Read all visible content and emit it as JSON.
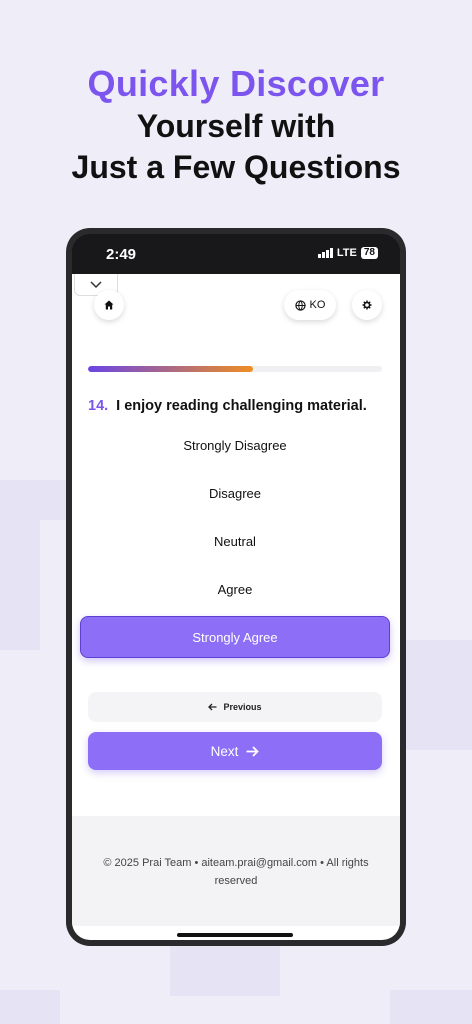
{
  "headline": {
    "accent": "Quickly Discover",
    "line1": "Yourself with",
    "line2": "Just a Few Questions"
  },
  "statusbar": {
    "time": "2:49",
    "network": "LTE",
    "battery": "78"
  },
  "app": {
    "language_label": "KO",
    "progress_fraction": 0.56,
    "question": {
      "number": "14.",
      "text": "I enjoy reading challenging material."
    },
    "options": [
      {
        "label": "Strongly Disagree",
        "selected": false
      },
      {
        "label": "Disagree",
        "selected": false
      },
      {
        "label": "Neutral",
        "selected": false
      },
      {
        "label": "Agree",
        "selected": false
      },
      {
        "label": "Strongly Agree",
        "selected": true
      }
    ],
    "previous_label": "Previous",
    "next_label": "Next",
    "footer": "© 2025 Prai Team • aiteam.prai@gmail.com • All rights reserved"
  },
  "colors": {
    "accent": "#7b55ee",
    "button": "#8d6ef7",
    "progress_start": "#6a45e6",
    "progress_end": "#ee8e22"
  },
  "icons": [
    "chevron-down-icon",
    "home-icon",
    "globe-icon",
    "gear-icon",
    "arrow-left-icon",
    "arrow-right-icon",
    "signal-icon",
    "battery-icon"
  ]
}
